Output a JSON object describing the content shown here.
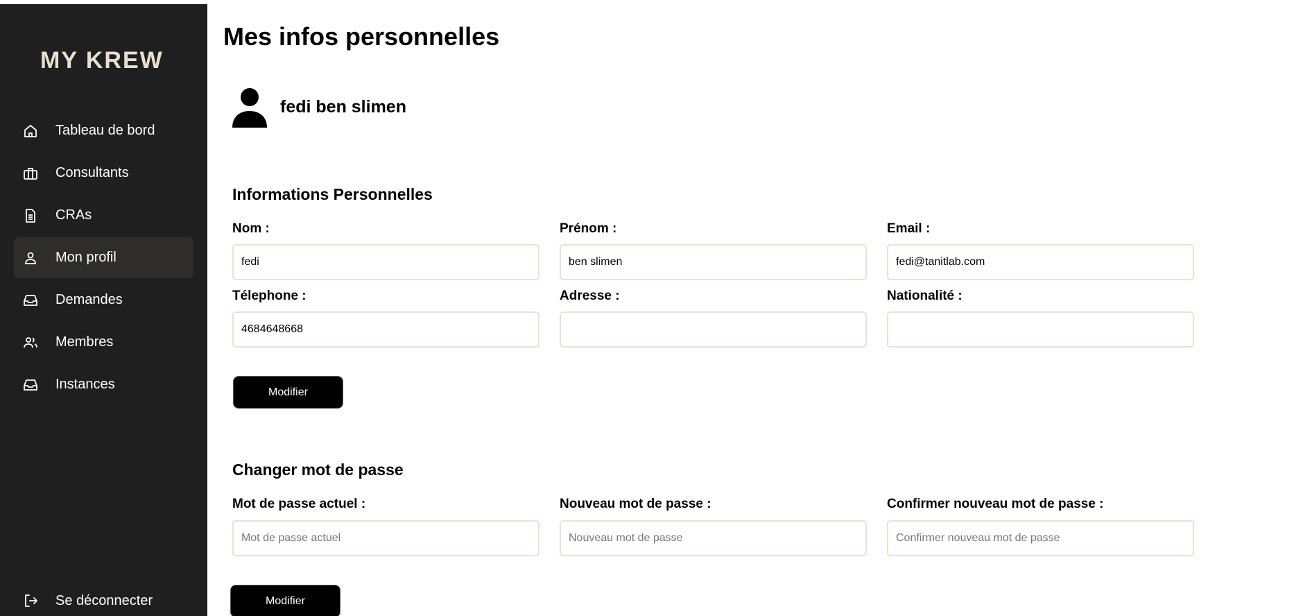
{
  "app": {
    "logo_text": "MY KREW"
  },
  "sidebar": {
    "items": [
      {
        "label": "Tableau de bord",
        "icon": "home-icon"
      },
      {
        "label": "Consultants",
        "icon": "briefcase-icon"
      },
      {
        "label": "CRAs",
        "icon": "document-icon"
      },
      {
        "label": "Mon profil",
        "icon": "user-icon",
        "active": true
      },
      {
        "label": "Demandes",
        "icon": "inbox-icon"
      },
      {
        "label": "Membres",
        "icon": "users-icon"
      },
      {
        "label": "Instances",
        "icon": "inbox-icon"
      }
    ],
    "logout_label": "Se déconnecter"
  },
  "page": {
    "title": "Mes infos personnelles",
    "user_name": "fedi ben slimen"
  },
  "personal": {
    "title": "Informations Personnelles",
    "nom_label": "Nom :",
    "nom_value": "fedi",
    "prenom_label": "Prénom :",
    "prenom_value": "ben slimen",
    "email_label": "Email :",
    "email_value": "fedi@tanitlab.com",
    "telephone_label": "Télephone :",
    "telephone_value": "4684648668",
    "adresse_label": "Adresse :",
    "adresse_value": "",
    "nationalite_label": "Nationalité :",
    "nationalite_value": "",
    "submit_label": "Modifier"
  },
  "password": {
    "title": "Changer mot de passe",
    "current_label": "Mot de passe actuel :",
    "current_placeholder": "Mot de passe actuel",
    "new_label": "Nouveau mot de passe :",
    "new_placeholder": "Nouveau mot de passe",
    "confirm_label": "Confirmer nouveau mot de passe :",
    "confirm_placeholder": "Confirmer nouveau mot de passe",
    "submit_label": "Modifier"
  },
  "colors": {
    "sidebar_bg": "#1f1f1f",
    "active_item_bg": "#2e2d2b",
    "input_border": "#e8e3d3",
    "logo_accent": "#d9cfba"
  }
}
